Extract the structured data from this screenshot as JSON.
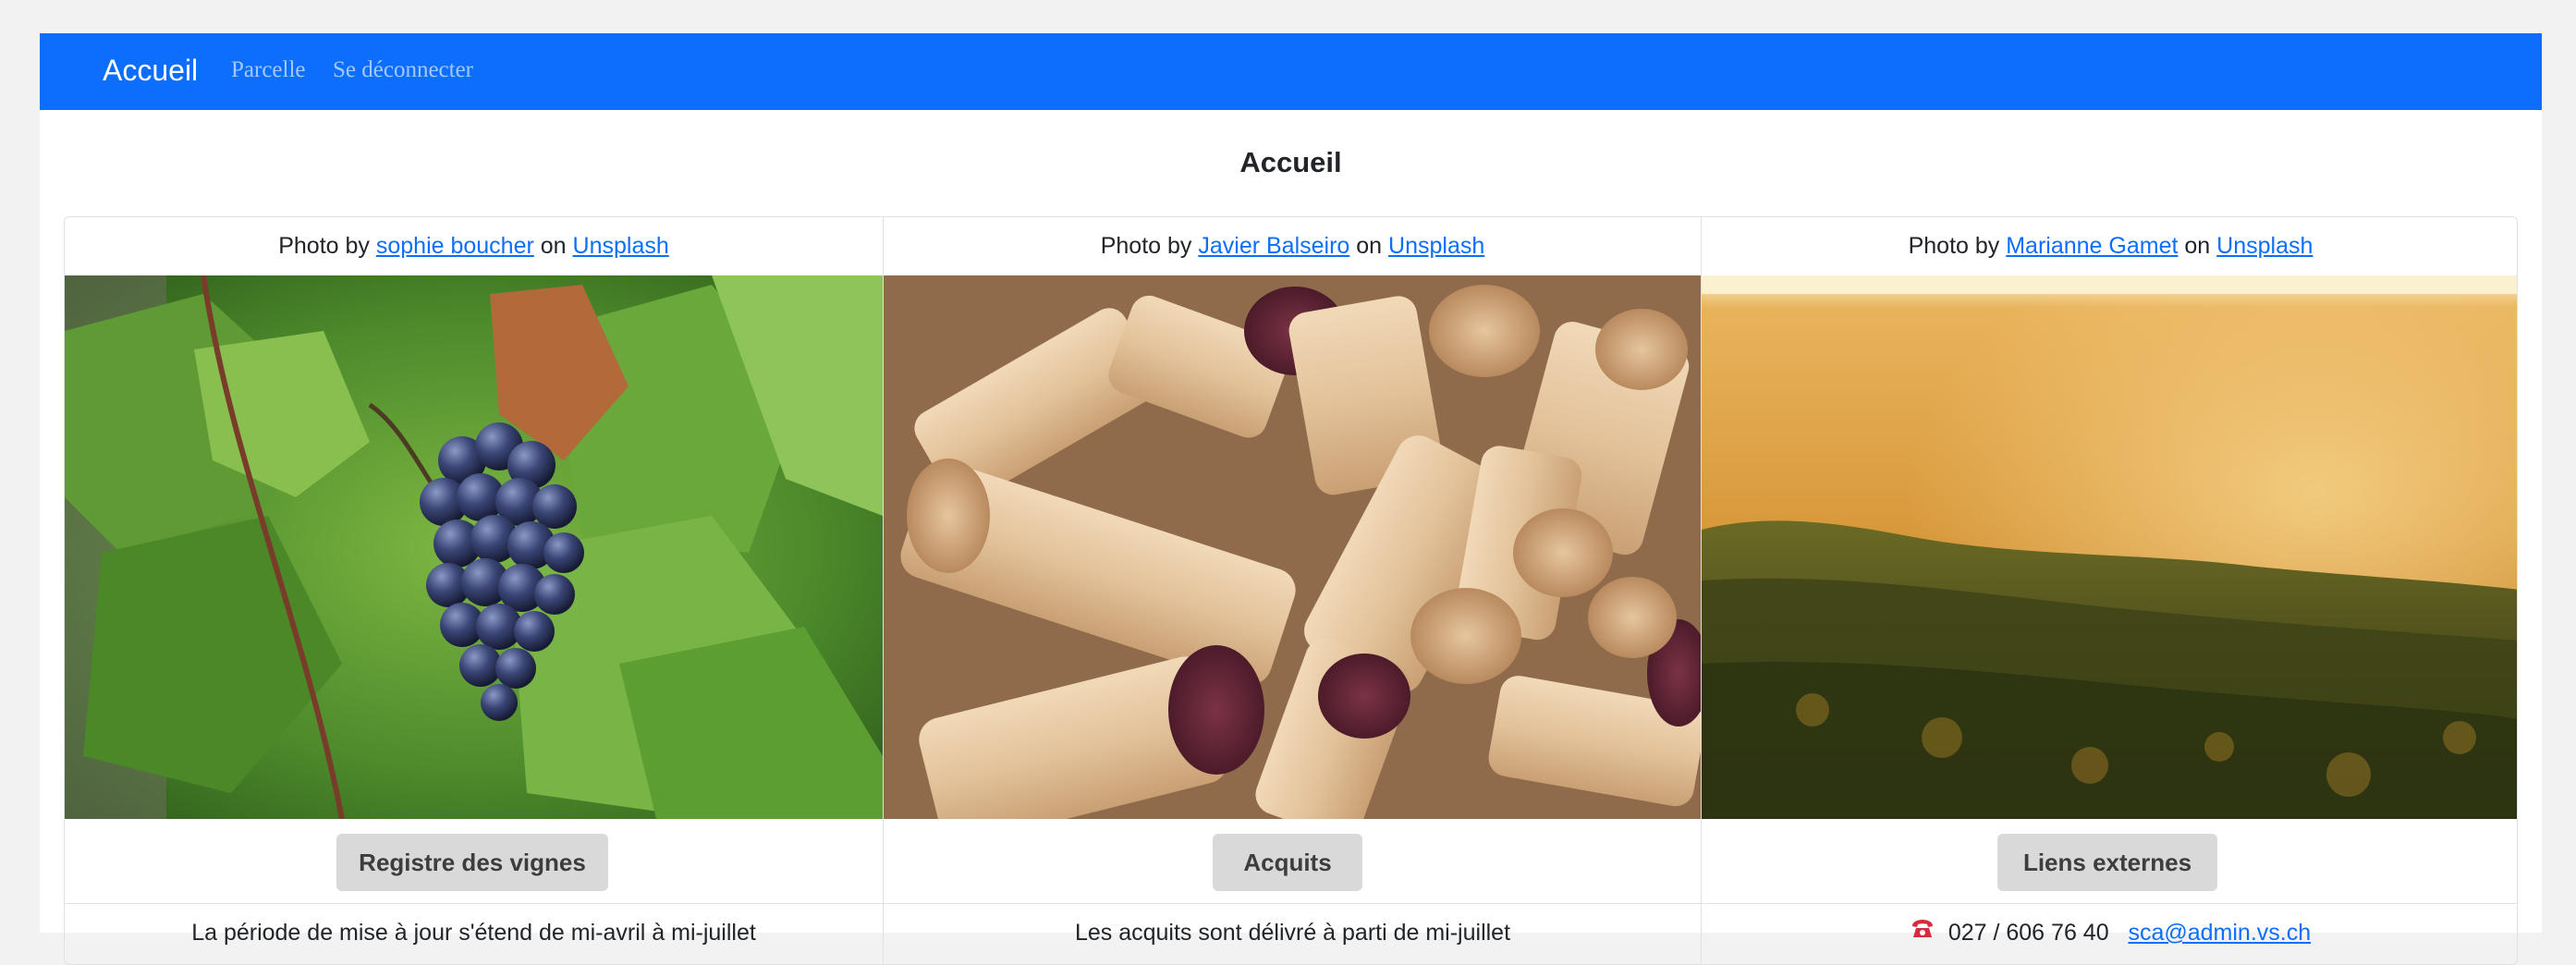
{
  "navbar": {
    "brand": "Accueil",
    "links": [
      "Parcelle",
      "Se déconnecter"
    ],
    "color": "#0d6efd"
  },
  "page": {
    "title": "Accueil"
  },
  "cards": [
    {
      "credit_prefix": "Photo by",
      "credit_author": "sophie boucher",
      "credit_middle": "on",
      "credit_site": "Unsplash",
      "photo_subject": "grape-vine-photo",
      "button_label": "Registre des vignes",
      "footer_text": "La période de mise à jour s'étend de mi-avril à mi-juillet"
    },
    {
      "credit_prefix": "Photo by",
      "credit_author": "Javier Balseiro",
      "credit_middle": "on",
      "credit_site": "Unsplash",
      "photo_subject": "wine-corks-photo",
      "button_label": "Acquits",
      "footer_text": "Les acquits sont délivré à parti de mi-juillet"
    },
    {
      "credit_prefix": "Photo by",
      "credit_author": "Marianne Gamet",
      "credit_middle": "on",
      "credit_site": "Unsplash",
      "photo_subject": "vineyard-sunset-photo",
      "button_label": "Liens externes",
      "footer_phone": "027 / 606 76 40",
      "footer_email": "sca@admin.vs.ch",
      "footer_icon": "telephone-icon"
    }
  ],
  "colors": {
    "button_bg": "#d9d9d9",
    "link": "#0d6efd",
    "phone_icon": "#d62b3a"
  }
}
